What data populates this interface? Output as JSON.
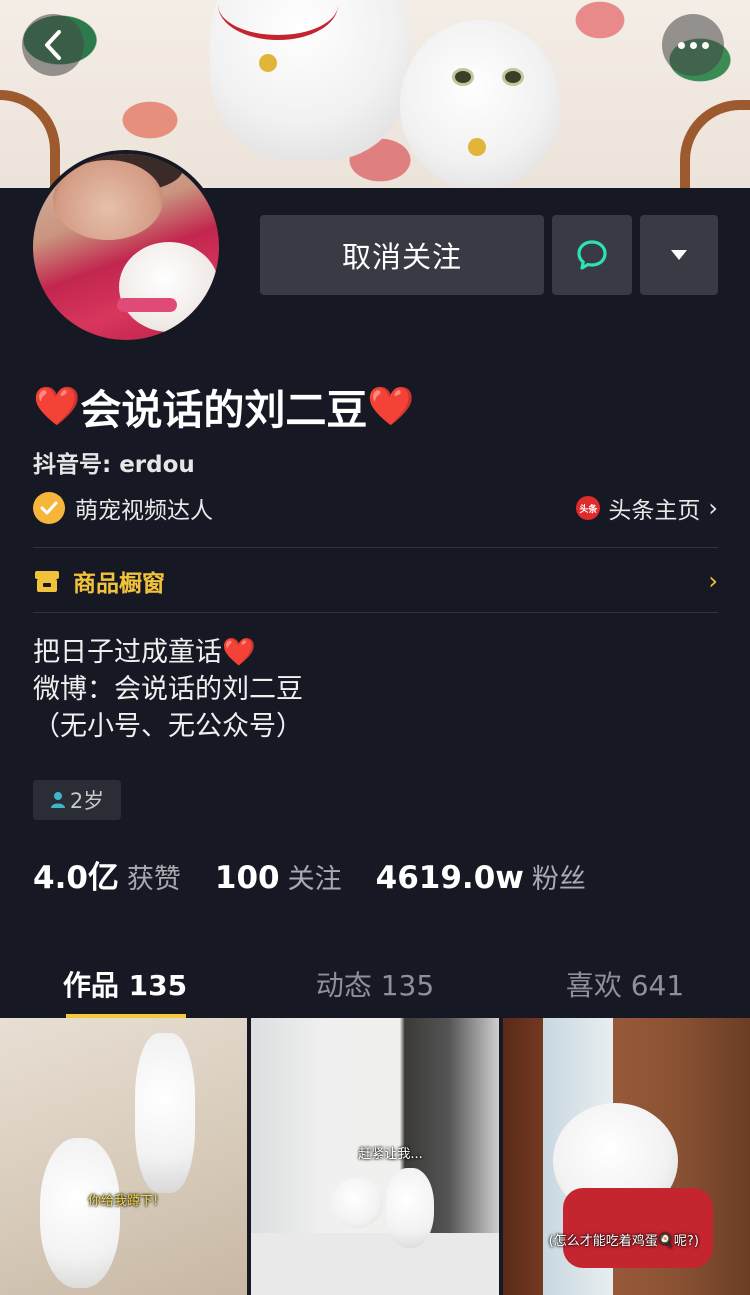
{
  "header": {
    "back_icon": "chevron-left-icon",
    "more_icon": "more-dots-icon"
  },
  "actions": {
    "unfollow_label": "取消关注",
    "message_icon": "chat-bubble-icon",
    "dropdown_icon": "triangle-down-icon"
  },
  "profile": {
    "name_heart_left": "❤️",
    "name": "会说话的刘二豆",
    "name_heart_right": "❤️",
    "douyin_id": "抖音号: erdou",
    "verified_label": "萌宠视频达人",
    "toutiao_badge": "头条",
    "toutiao_link": "头条主页",
    "toutiao_chevron": "›",
    "shop_label": "商品橱窗",
    "shop_chevron": "›",
    "bio_line1": "把日子过成童话",
    "bio_heart": "❤️",
    "bio_line2": "微博：会说话的刘二豆",
    "bio_line3": "（无小号、无公众号）",
    "age_tag": "2岁"
  },
  "stats": [
    {
      "num": "4.0亿",
      "label": "获赞"
    },
    {
      "num": "100",
      "label": "关注"
    },
    {
      "num": "4619.0w",
      "label": "粉丝"
    }
  ],
  "tabs": [
    {
      "label": "作品 135",
      "active": true
    },
    {
      "label": "动态 135",
      "active": false
    },
    {
      "label": "喜欢 641",
      "active": false
    }
  ],
  "videos": [
    {
      "caption": "你给我蹲下!"
    },
    {
      "caption": "赶紧让我..."
    },
    {
      "caption": "(怎么才能吃着鸡蛋🍳呢?)"
    }
  ],
  "colors": {
    "background": "#161823",
    "button_bg": "#393b44",
    "accent_yellow": "#f6c83e",
    "heart_red": "#e2262b",
    "verified_orange": "#f6b63b",
    "chat_green": "#2ee3b0"
  }
}
